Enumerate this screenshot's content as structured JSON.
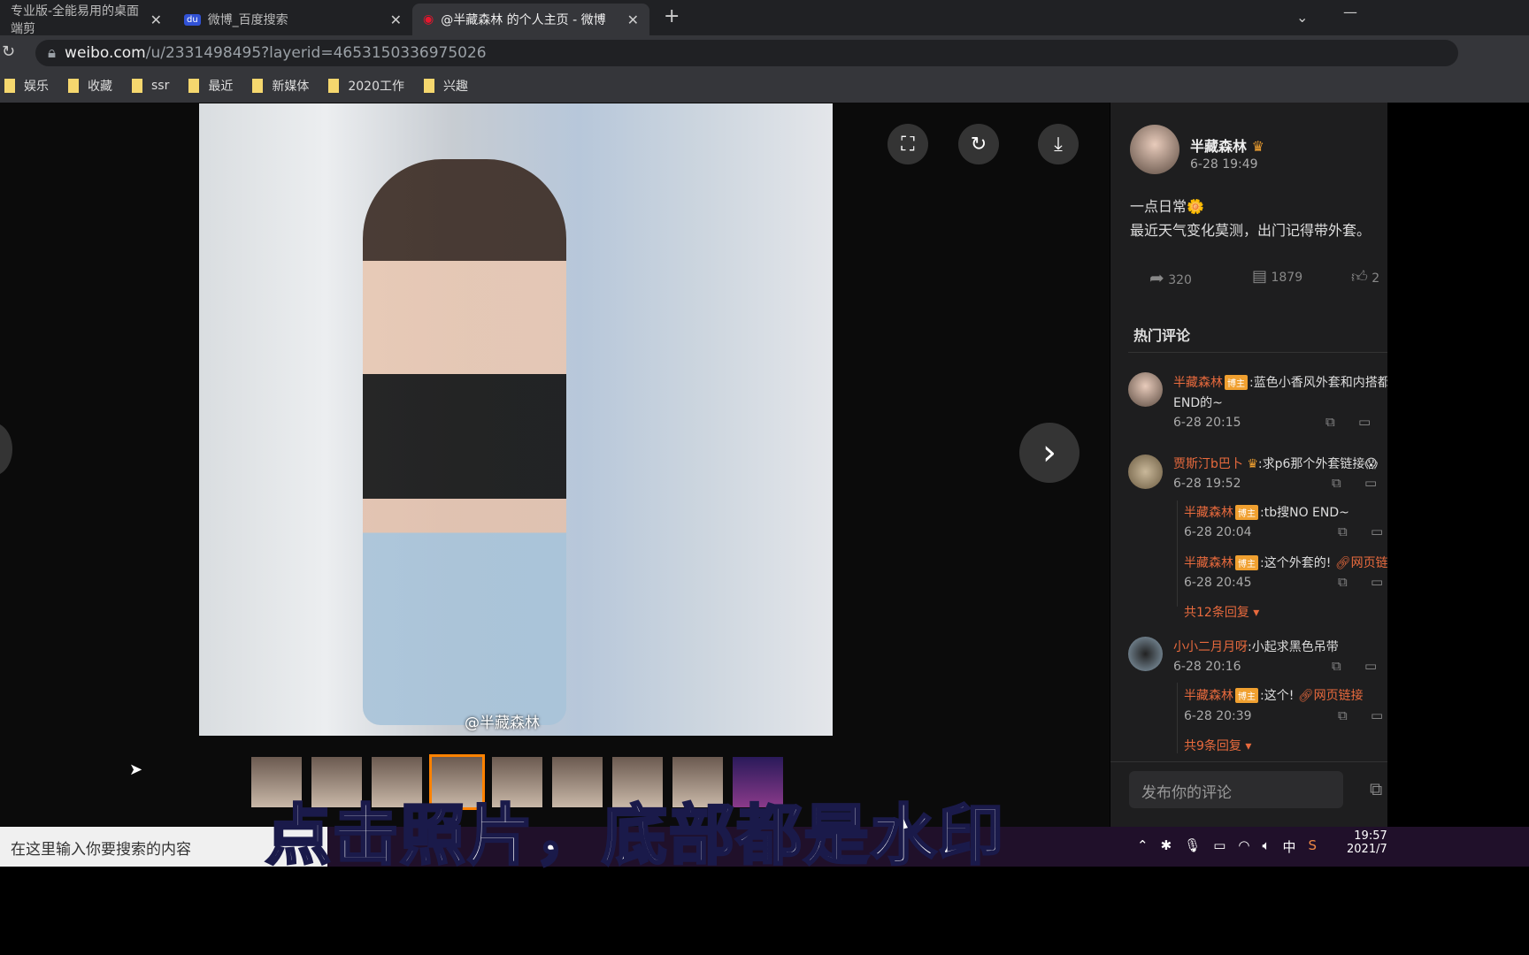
{
  "tabs": [
    {
      "title": "专业版-全能易用的桌面端剪",
      "icon": "app-icon"
    },
    {
      "title": "微博_百度搜索",
      "icon": "baidu-icon"
    },
    {
      "title": "@半藏森林 的个人主页 - 微博",
      "icon": "weibo-icon",
      "active": true
    }
  ],
  "address": {
    "host": "weibo.com",
    "path": "/u/2331498495?layerid=4653150336975026"
  },
  "bookmarks": [
    "娱乐",
    "收藏",
    "ssr",
    "最近",
    "新媒体",
    "2020工作",
    "兴趣"
  ],
  "viewer": {
    "watermark": "@半藏森林",
    "thumbnail_count": 9,
    "selected_thumbnail": 4
  },
  "post": {
    "author": "半藏森林",
    "time": "6-28 19:49",
    "text1": "一点日常🌼",
    "text2": "最近天气变化莫测，出门记得带外套。",
    "reposts": "320",
    "comments": "1879",
    "likes": "2"
  },
  "hot_comments_title": "热门评论",
  "comments": [
    {
      "name": "半藏森林",
      "tag": "博主",
      "text": ":蓝色小香风外套和内搭都是",
      "text2": "END的~",
      "time": "6-28 20:15"
    },
    {
      "name": "贾斯汀b巴卜",
      "text": ":求p6那个外套链接😱",
      "time": "6-28 19:52",
      "replies": [
        {
          "name": "半藏森林",
          "tag": "博主",
          "text": ":tb搜NO END~",
          "time": "6-28 20:04"
        },
        {
          "name": "半藏森林",
          "tag": "博主",
          "text": ":这个外套的!",
          "link": "网页链接",
          "time": "6-28 20:45"
        }
      ],
      "more": "共12条回复"
    },
    {
      "name": "小小二月月呀",
      "text": ":小起求黑色吊带",
      "time": "6-28 20:16",
      "replies": [
        {
          "name": "半藏森林",
          "tag": "博主",
          "text": ":这个!",
          "link": "网页链接",
          "time": "6-28 20:39"
        }
      ],
      "more": "共9条回复"
    }
  ],
  "comment_placeholder": "发布你的评论",
  "taskbar": {
    "search": "在这里输入你要搜索的内容",
    "ime": "中",
    "time": "19:57",
    "date": "2021/7"
  },
  "subtitle": "点击照片，底部都是水印",
  "colors": {
    "accent": "#ff8200",
    "name": "#e86a3d",
    "tag": "#f0a030"
  }
}
